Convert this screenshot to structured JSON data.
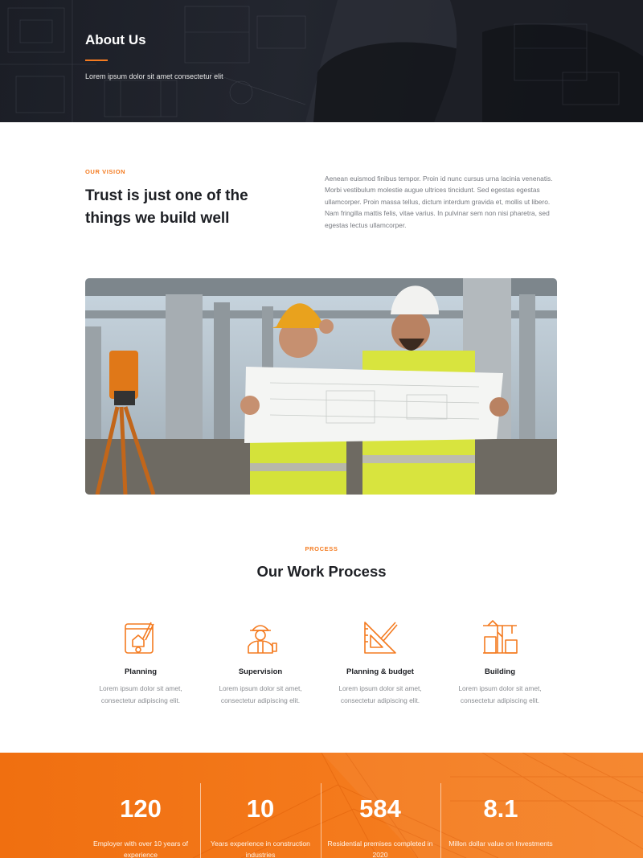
{
  "hero": {
    "title": "About Us",
    "subtitle": "Lorem ipsum dolor sit amet consectetur elit"
  },
  "vision": {
    "eyebrow": "OUR VISION",
    "title": "Trust is just one of the things we build well",
    "text": "Aenean euismod finibus tempor. Proin id nunc cursus urna lacinia venenatis. Morbi vestibulum molestie augue ultrices tincidunt. Sed egestas egestas ullamcorper. Proin massa tellus, dictum interdum gravida et, mollis ut libero. Nam fringilla mattis felis, vitae varius. In pulvinar sem non nisi pharetra, sed egestas lectus ullamcorper."
  },
  "photo": {
    "subject": "two construction engineers in hard hats reviewing blueprints"
  },
  "process": {
    "eyebrow": "PROCESS",
    "title": "Our Work Process",
    "steps": [
      {
        "icon": "blueprint-icon",
        "title": "Planning",
        "desc": "Lorem ipsum dolor sit amet, consectetur adipiscing elit."
      },
      {
        "icon": "worker-icon",
        "title": "Supervision",
        "desc": "Lorem ipsum dolor sit amet, consectetur adipiscing elit."
      },
      {
        "icon": "ruler-triangle-icon",
        "title": "Planning & budget",
        "desc": "Lorem ipsum dolor sit amet, consectetur adipiscing elit."
      },
      {
        "icon": "crane-building-icon",
        "title": "Building",
        "desc": "Lorem ipsum dolor sit amet, consectetur adipiscing elit."
      }
    ]
  },
  "stats": [
    {
      "value": "120",
      "label": "Employer with over 10 years of experience"
    },
    {
      "value": "10",
      "label": "Years experience in construction industries"
    },
    {
      "value": "584",
      "label": "Residential premises completed in 2020"
    },
    {
      "value": "8.1",
      "label": "Millon dollar value on Investments"
    }
  ],
  "colors": {
    "accent": "#f47b20",
    "hero_bg": "#1f222a",
    "heading": "#1d1f24",
    "body_text": "#777a80"
  }
}
